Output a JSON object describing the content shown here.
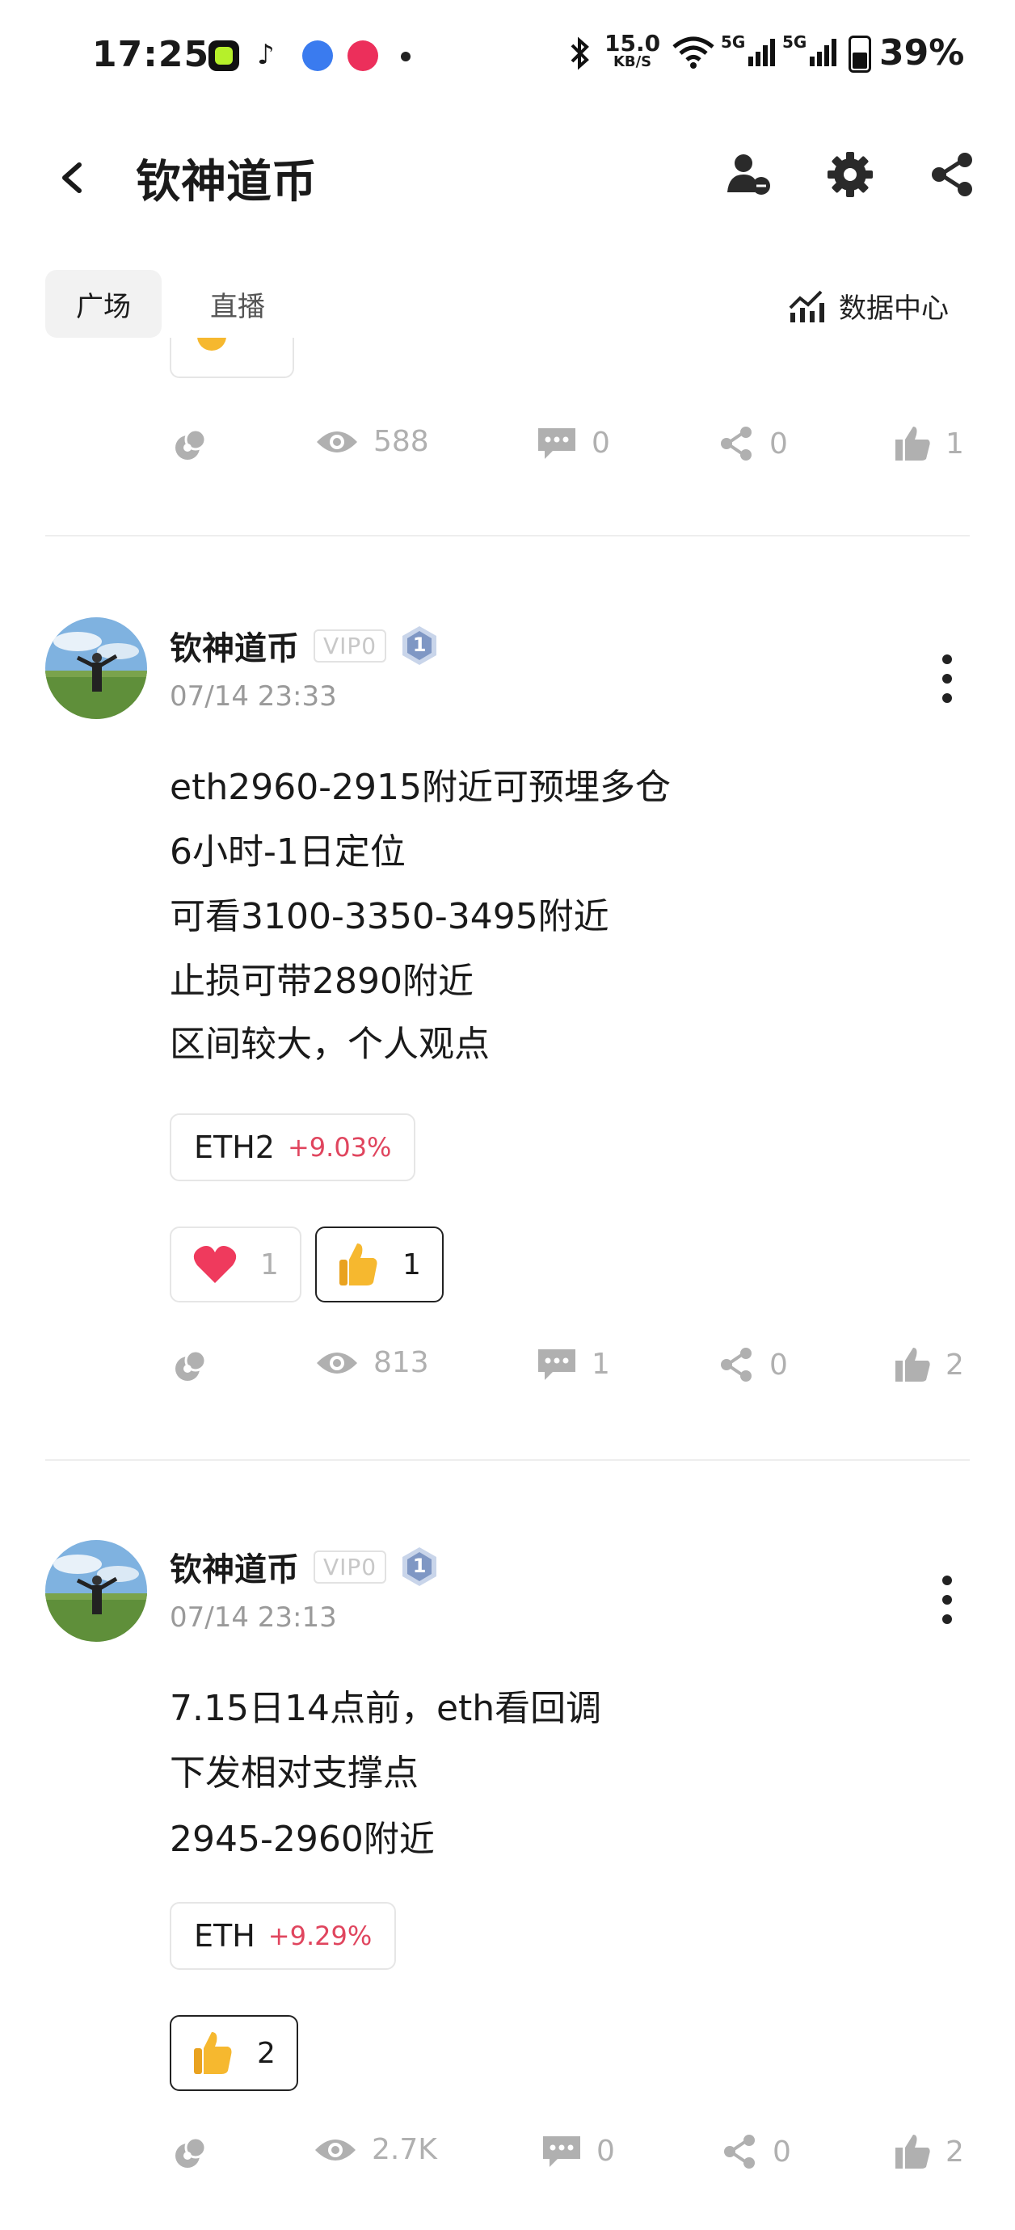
{
  "status_bar": {
    "time": "17:25",
    "net_speed": "15.0",
    "net_unit": "KB/S",
    "signal1": "5G",
    "signal2": "5G",
    "battery": "39%"
  },
  "header": {
    "title": "钦神道币"
  },
  "tabs": [
    {
      "label": "广场",
      "active": true
    },
    {
      "label": "直播",
      "active": false
    }
  ],
  "data_center_label": "数据中心",
  "top_post": {
    "views": "588",
    "comments": "0",
    "shares": "0",
    "likes": "1"
  },
  "posts": [
    {
      "author": "钦神道币",
      "vip": "VIP0",
      "level": "1",
      "date": "07/14 23:33",
      "lines": [
        "eth2960-2915附近可预埋多仓",
        "6小时-1日定位",
        "可看3100-3350-3495附近",
        "止损可带2890附近",
        "区间较大，个人观点"
      ],
      "coin": "ETH2",
      "coin_change": "+9.03%",
      "heart_count": "1",
      "thumb_count": "1",
      "views": "813",
      "comments": "1",
      "shares": "0",
      "likes": "2"
    },
    {
      "author": "钦神道币",
      "vip": "VIP0",
      "level": "1",
      "date": "07/14 23:13",
      "lines": [
        "7.15日14点前，eth看回调",
        "下发相对支撑点",
        "2945-2960附近"
      ],
      "coin": "ETH",
      "coin_change": "+9.29%",
      "thumb_count": "2",
      "views": "2.7K",
      "comments": "0",
      "shares": "0",
      "likes": "2"
    }
  ],
  "colors": {
    "accent_red": "#e0455e",
    "muted_gray": "#b0b0b0",
    "tab_bg": "#f2f2f2"
  }
}
